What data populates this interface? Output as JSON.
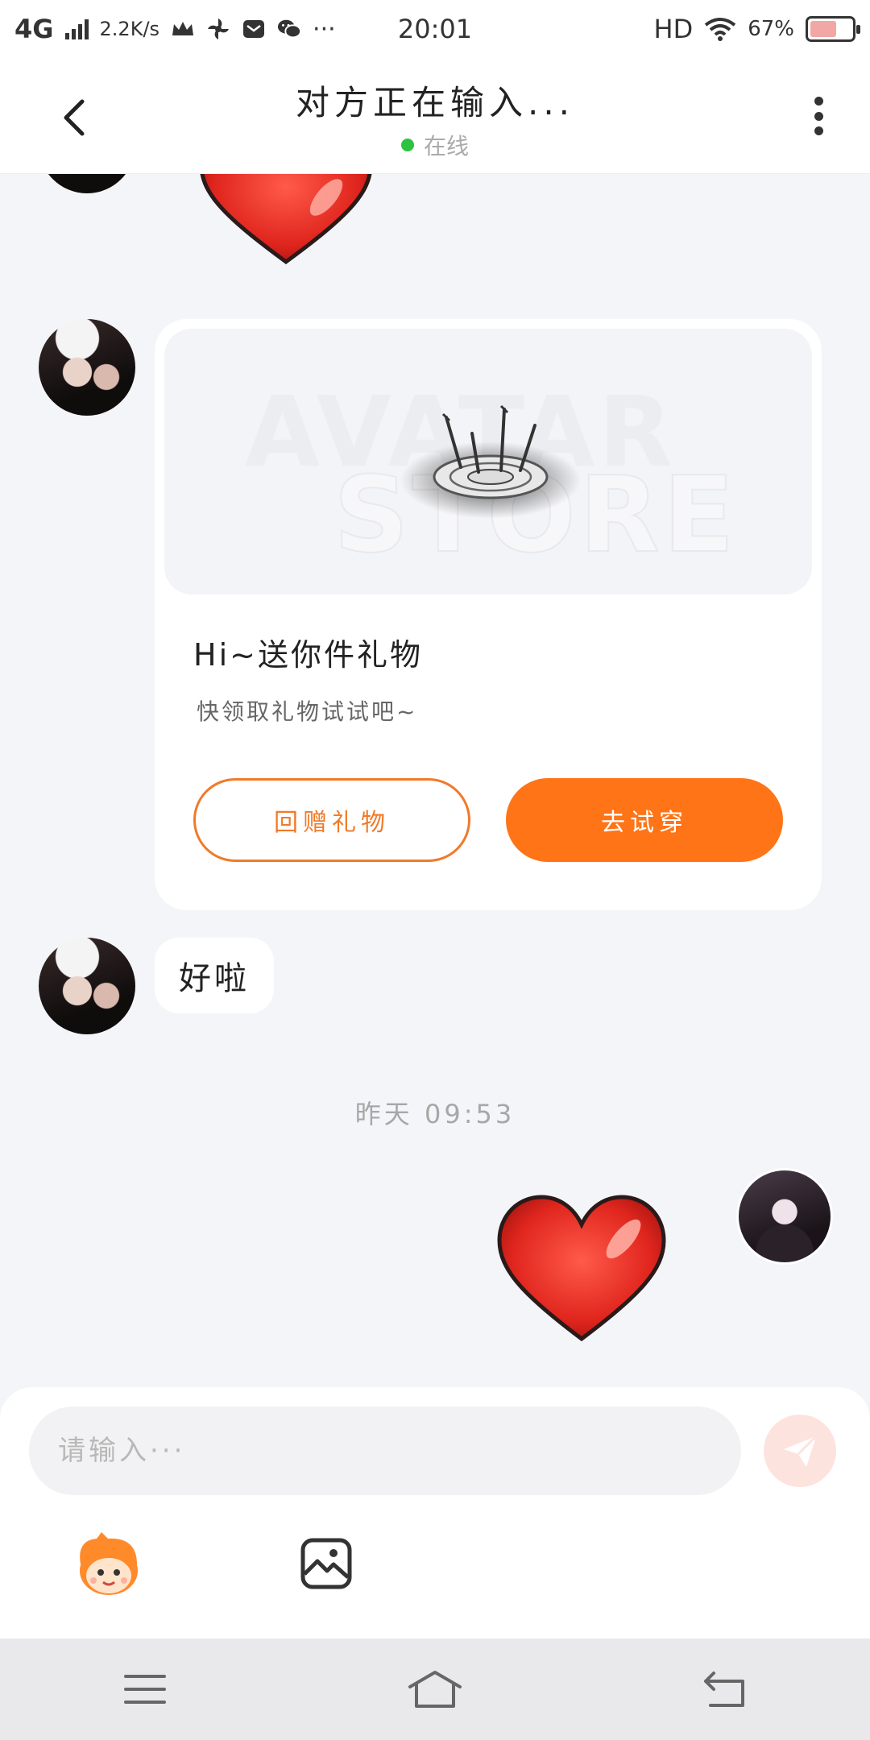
{
  "status_bar": {
    "network": "4G",
    "speed": "2.2K/s",
    "more": "···",
    "time": "20:01",
    "hd": "HD",
    "battery": "67%",
    "battery_level": 0.67
  },
  "header": {
    "title": "对方正在输入...",
    "status": "在线",
    "status_color": "#2dc23f"
  },
  "messages": {
    "gift_card": {
      "watermark_top": "AVATAR",
      "watermark_bottom": "STORE",
      "title": "Hi~送你件礼物",
      "subtitle": "快领取礼物试试吧~",
      "return_label": "回赠礼物",
      "try_label": "去试穿"
    },
    "text_bubble": "好啦",
    "timestamp": "昨天 09:53"
  },
  "input": {
    "placeholder": "请输入···"
  },
  "icons": {
    "back": "back-arrow-icon",
    "more": "more-vertical-icon",
    "send": "send-icon",
    "emoji": "emoji-mascot-icon",
    "image": "image-icon",
    "nav_menu": "menu-icon",
    "nav_home": "home-icon",
    "nav_back": "nav-back-icon"
  },
  "colors": {
    "accent": "#ff7417",
    "background": "#f4f5f8",
    "heart": "#e8302a"
  }
}
